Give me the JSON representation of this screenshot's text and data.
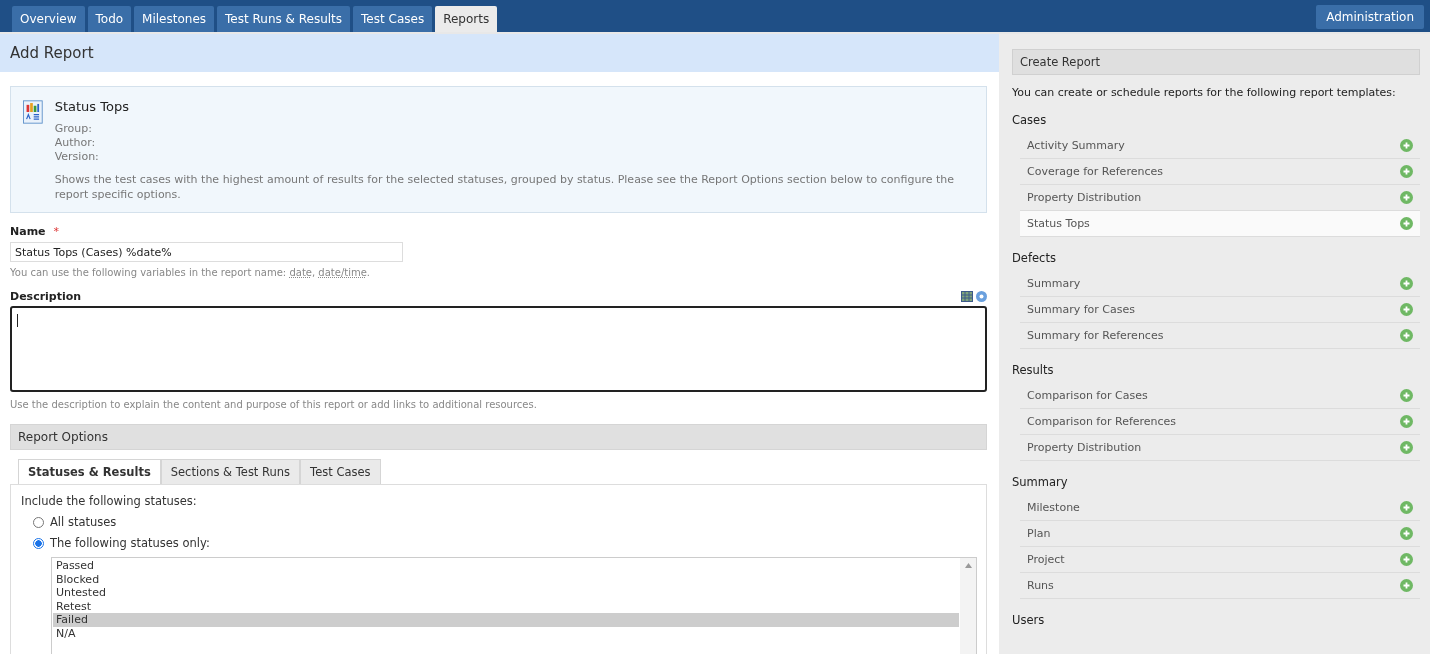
{
  "nav": {
    "tabs": [
      {
        "label": "Overview",
        "selected": false
      },
      {
        "label": "Todo",
        "selected": false
      },
      {
        "label": "Milestones",
        "selected": false
      },
      {
        "label": "Test Runs & Results",
        "selected": false
      },
      {
        "label": "Test Cases",
        "selected": false
      },
      {
        "label": "Reports",
        "selected": true
      }
    ],
    "admin": "Administration"
  },
  "page_title": "Add Report",
  "template": {
    "title": "Status Tops",
    "meta": [
      "Group:",
      "Author:",
      "Version:"
    ],
    "description": "Shows the test cases with the highest amount of results for the selected statuses, grouped by status. Please see the Report Options section below to configure the report specific options."
  },
  "name_field": {
    "label": "Name",
    "required": "*",
    "value": "Status Tops (Cases) %date%",
    "hint": [
      {
        "kind": "text",
        "text": "You can use the following variables in the report name: "
      },
      {
        "kind": "link",
        "text": "date"
      },
      {
        "kind": "text",
        "text": ", "
      },
      {
        "kind": "link",
        "text": "date/time"
      },
      {
        "kind": "text",
        "text": "."
      }
    ]
  },
  "description_field": {
    "label": "Description",
    "focused": true,
    "hint": "Use the description to explain the content and purpose of this report or add links to additional resources."
  },
  "report_options": {
    "title": "Report Options",
    "tabs": [
      {
        "label": "Statuses & Results",
        "selected": true
      },
      {
        "label": "Sections & Test Runs",
        "selected": false
      },
      {
        "label": "Test Cases",
        "selected": false
      }
    ],
    "prompt": "Include the following statuses:",
    "radios": [
      {
        "label": "All statuses",
        "selected": false
      },
      {
        "label": "The following statuses only:",
        "selected": true
      }
    ],
    "statuses": [
      {
        "label": "Passed",
        "selected": false
      },
      {
        "label": "Blocked",
        "selected": false
      },
      {
        "label": "Untested",
        "selected": false
      },
      {
        "label": "Retest",
        "selected": false
      },
      {
        "label": "Failed",
        "selected": true
      },
      {
        "label": "N/A",
        "selected": false
      }
    ]
  },
  "sidebar": {
    "title": "Create Report",
    "intro": "You can create or schedule reports for the following report templates:",
    "groups": [
      {
        "name": "Cases",
        "items": [
          {
            "label": "Activity Summary",
            "selected": false
          },
          {
            "label": "Coverage for References",
            "selected": false
          },
          {
            "label": "Property Distribution",
            "selected": false
          },
          {
            "label": "Status Tops",
            "selected": true
          }
        ]
      },
      {
        "name": "Defects",
        "items": [
          {
            "label": "Summary",
            "selected": false
          },
          {
            "label": "Summary for Cases",
            "selected": false
          },
          {
            "label": "Summary for References",
            "selected": false
          }
        ]
      },
      {
        "name": "Results",
        "items": [
          {
            "label": "Comparison for Cases",
            "selected": false
          },
          {
            "label": "Comparison for References",
            "selected": false
          },
          {
            "label": "Property Distribution",
            "selected": false
          }
        ]
      },
      {
        "name": "Summary",
        "items": [
          {
            "label": "Milestone",
            "selected": false
          },
          {
            "label": "Plan",
            "selected": false
          },
          {
            "label": "Project",
            "selected": false
          },
          {
            "label": "Runs",
            "selected": false
          }
        ]
      },
      {
        "name": "Users"
      }
    ]
  }
}
